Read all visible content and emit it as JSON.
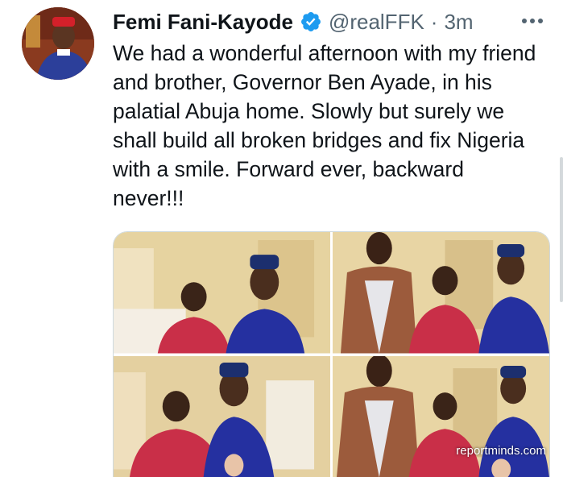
{
  "tweet": {
    "author_name": "Femi Fani-Kayode",
    "author_handle": "@realFFK",
    "separator": "·",
    "time": "3m",
    "verified": true,
    "text": "We had a wonderful afternoon with my friend and brother, Governor Ben Ayade, in his palatial Abuja home. Slowly but surely we shall build all broken bridges and fix Nigeria with a smile. Forward ever, backward never!!!"
  },
  "media": {
    "watermark": "reportminds.com"
  },
  "icons": {
    "verified": "verified-badge-icon",
    "more": "more-options-icon"
  },
  "colors": {
    "verified_blue": "#1d9bf0",
    "text_primary": "#0f1419",
    "text_secondary": "#536471"
  }
}
